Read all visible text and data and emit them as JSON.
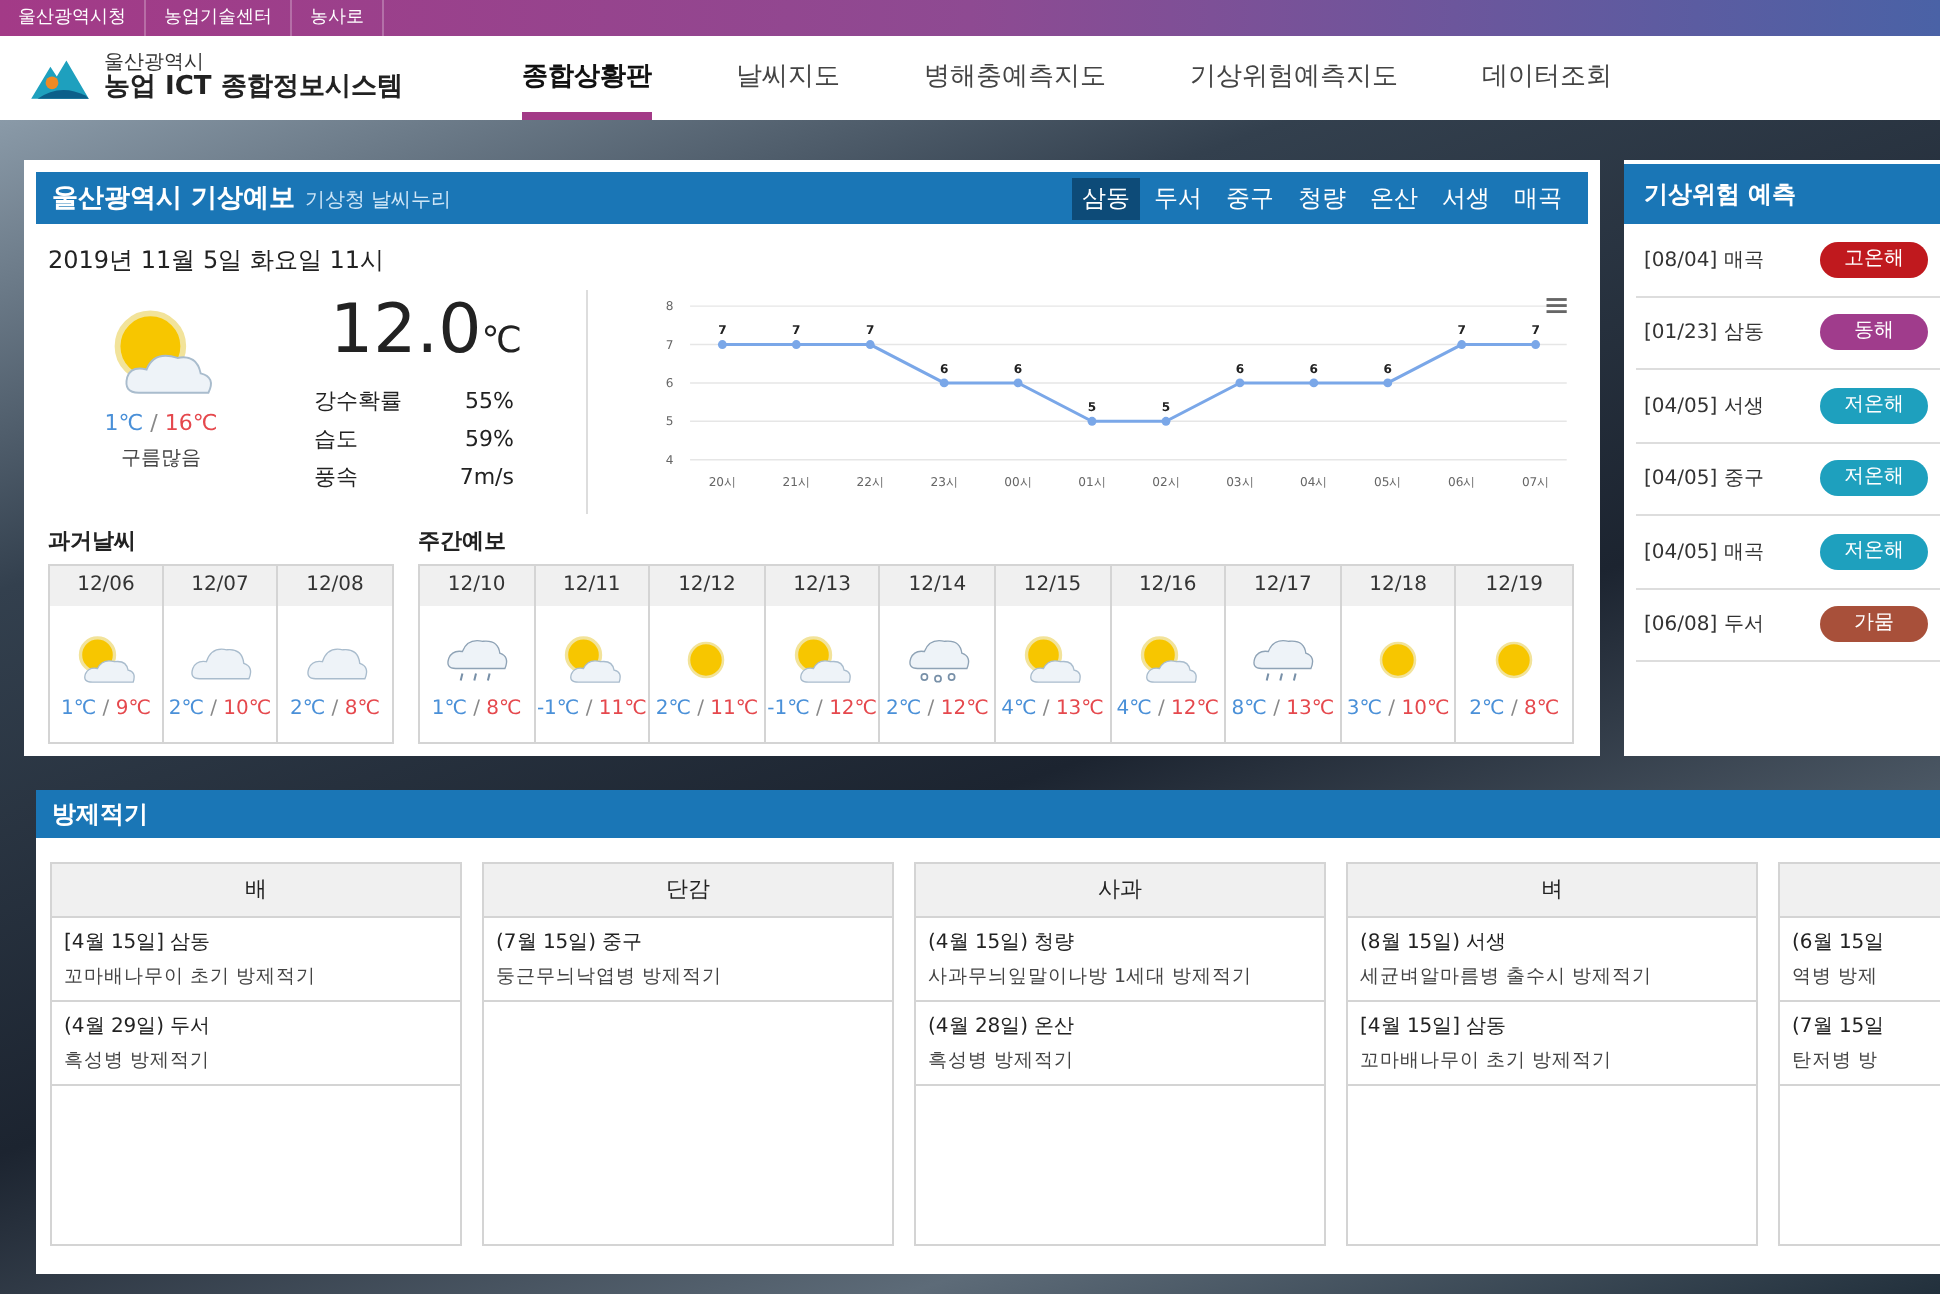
{
  "top_links": [
    "울산광역시청",
    "농업기술센터",
    "농사로"
  ],
  "logo": {
    "sub": "울산광역시",
    "main": "농업 ICT 종합정보시스템"
  },
  "nav": [
    {
      "label": "종합상황판",
      "selected": true
    },
    {
      "label": "날씨지도",
      "selected": false
    },
    {
      "label": "병해충예측지도",
      "selected": false
    },
    {
      "label": "기상위험예측지도",
      "selected": false
    },
    {
      "label": "데이터조회",
      "selected": false
    }
  ],
  "forecast": {
    "title": "울산광역시 기상예보",
    "source": "기상청 날씨누리",
    "districts": [
      {
        "label": "삼동",
        "selected": true
      },
      {
        "label": "두서",
        "selected": false
      },
      {
        "label": "중구",
        "selected": false
      },
      {
        "label": "청량",
        "selected": false
      },
      {
        "label": "온산",
        "selected": false
      },
      {
        "label": "서생",
        "selected": false
      },
      {
        "label": "매곡",
        "selected": false
      }
    ],
    "datetime": "2019년 11월 5일 화요일 11시",
    "current": {
      "kind": "partly-cloudy",
      "low": "1℃",
      "high": "16℃",
      "condition": "구름많음",
      "temperature": "12.0",
      "unit": "℃",
      "stats": [
        {
          "label": "강수확률",
          "value": "55%"
        },
        {
          "label": "습도",
          "value": "59%"
        },
        {
          "label": "풍속",
          "value": "7m/s"
        }
      ]
    },
    "chart_data": {
      "type": "line",
      "categories": [
        "20시",
        "21시",
        "22시",
        "23시",
        "00시",
        "01시",
        "02시",
        "03시",
        "04시",
        "05시",
        "06시",
        "07시"
      ],
      "series": [
        {
          "color": "#7aa7e8",
          "marker": true,
          "values": [
            7,
            7,
            7,
            6,
            6,
            5,
            5,
            6,
            6,
            6,
            7,
            7
          ]
        }
      ],
      "ylim": [
        4,
        8
      ],
      "yticks": [
        4,
        5,
        6,
        7,
        8
      ],
      "grid": true,
      "data_labels": true
    },
    "temp_separator": "/",
    "past_title": "과거날씨",
    "past": [
      {
        "date": "12/06",
        "kind": "partly-cloudy",
        "low": "1℃",
        "high": "9℃"
      },
      {
        "date": "12/07",
        "kind": "cloudy",
        "low": "2℃",
        "high": "10℃"
      },
      {
        "date": "12/08",
        "kind": "cloudy",
        "low": "2℃",
        "high": "8℃"
      }
    ],
    "weekly_title": "주간예보",
    "weekly": [
      {
        "date": "12/10",
        "kind": "rain",
        "low": "1℃",
        "high": "8℃"
      },
      {
        "date": "12/11",
        "kind": "partly-cloudy",
        "low": "-1℃",
        "high": "11℃"
      },
      {
        "date": "12/12",
        "kind": "sunny",
        "low": "2℃",
        "high": "11℃"
      },
      {
        "date": "12/13",
        "kind": "partly-cloudy",
        "low": "-1℃",
        "high": "12℃"
      },
      {
        "date": "12/14",
        "kind": "snow",
        "low": "2℃",
        "high": "12℃"
      },
      {
        "date": "12/15",
        "kind": "partly-cloudy",
        "low": "4℃",
        "high": "13℃"
      },
      {
        "date": "12/16",
        "kind": "partly-cloudy",
        "low": "4℃",
        "high": "12℃"
      },
      {
        "date": "12/17",
        "kind": "rain",
        "low": "8℃",
        "high": "13℃"
      },
      {
        "date": "12/18",
        "kind": "sunny",
        "low": "3℃",
        "high": "10℃"
      },
      {
        "date": "12/19",
        "kind": "sunny",
        "low": "2℃",
        "high": "8℃"
      }
    ]
  },
  "risk": {
    "title": "기상위험 예측",
    "items": [
      {
        "date": "[08/04] 매곡",
        "tag": "고온해",
        "color": "#c0191e"
      },
      {
        "date": "[01/23] 삼동",
        "tag": "동해",
        "color": "#a03c8c"
      },
      {
        "date": "[04/05] 서생",
        "tag": "저온해",
        "color": "#1ea0be"
      },
      {
        "date": "[04/05] 중구",
        "tag": "저온해",
        "color": "#1ea0be"
      },
      {
        "date": "[04/05] 매곡",
        "tag": "저온해",
        "color": "#1ea0be"
      },
      {
        "date": "[06/08] 두서",
        "tag": "가뭄",
        "color": "#a8503a"
      }
    ]
  },
  "control": {
    "title": "방제적기",
    "crops": [
      {
        "name": "배",
        "entries": [
          {
            "when": "[4월 15일]  삼동",
            "task": "꼬마배나무이 초기 방제적기"
          },
          {
            "when": "(4월 29일)  두서",
            "task": "흑성병 방제적기"
          }
        ]
      },
      {
        "name": "단감",
        "entries": [
          {
            "when": "(7월 15일)  중구",
            "task": "둥근무늬낙엽병 방제적기"
          }
        ]
      },
      {
        "name": "사과",
        "entries": [
          {
            "when": "(4월 15일)  청량",
            "task": "사과무늬잎말이나방 1세대 방제적기"
          },
          {
            "when": "(4월 28일)  온산",
            "task": "흑성병 방제적기"
          }
        ]
      },
      {
        "name": "벼",
        "entries": [
          {
            "when": "(8월 15일) 서생",
            "task": "세균벼알마름병 출수시 방제적기"
          },
          {
            "when": "[4월 15일]  삼동",
            "task": "꼬마배나무이 초기 방제적기"
          }
        ]
      },
      {
        "entries": [
          {
            "when": "(6월 15일",
            "task": "역병 방제"
          },
          {
            "when": "(7월 15일",
            "task": "탄저병 방"
          }
        ]
      }
    ]
  }
}
